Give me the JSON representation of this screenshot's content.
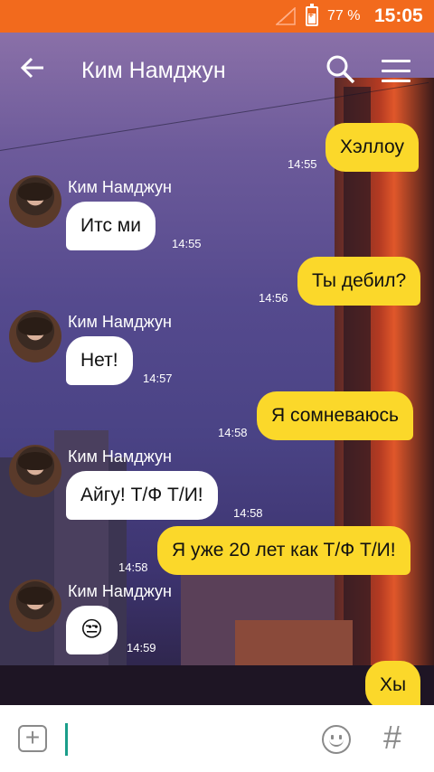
{
  "status_bar": {
    "battery": "77 %",
    "time": "15:05"
  },
  "header": {
    "title": "Ким Намджун"
  },
  "messages": [
    {
      "text": "Хэллоу",
      "time": "14:55"
    },
    {
      "sender": "Ким Намджун",
      "text": "Итс ми",
      "time": "14:55"
    },
    {
      "text": "Ты дебил?",
      "time": "14:56"
    },
    {
      "sender": "Ким Намджун",
      "text": "Нет!",
      "time": "14:57"
    },
    {
      "text": "Я сомневаюсь",
      "time": "14:58"
    },
    {
      "sender": "Ким Намджун",
      "text": "Айгу! Т/Ф Т/И!",
      "time": "14:58"
    },
    {
      "text": "Я уже 20 лет как Т/Ф Т/И!",
      "time": "14:58"
    },
    {
      "sender": "Ким Намджун",
      "text": "😒",
      "time": "14:59"
    },
    {
      "text": "Хы"
    }
  ],
  "input": {
    "placeholder": ""
  },
  "icons": {
    "back": "arrow-left-icon",
    "search": "search-icon",
    "menu": "menu-icon",
    "attach": "plus-square-icon",
    "emoji": "smiley-icon",
    "hash": "hash-icon"
  },
  "colors": {
    "status_bar": "#f26a1d",
    "outgoing_bubble": "#fbd82a",
    "incoming_bubble": "#ffffff",
    "caret": "#1a9e8a"
  }
}
